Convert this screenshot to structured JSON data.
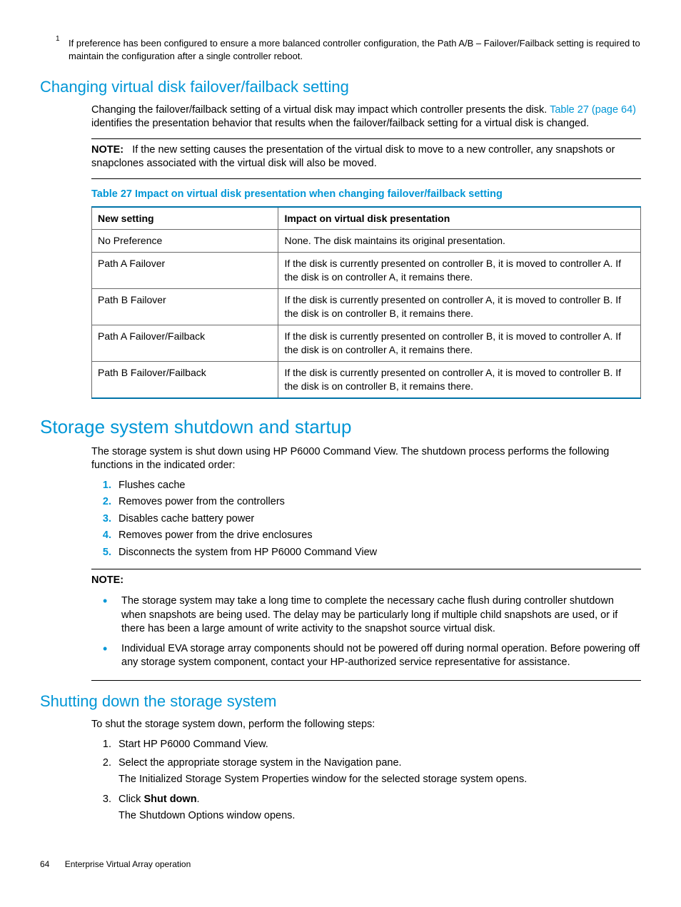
{
  "footnote": {
    "marker": "1",
    "text": "If preference has been configured to ensure a more balanced controller configuration, the Path A/B – Failover/Failback setting is required to maintain the configuration after a single controller reboot."
  },
  "section1": {
    "heading": "Changing virtual disk failover/failback setting",
    "p1a": "Changing the failover/failback setting of a virtual disk may impact which controller presents the disk. ",
    "p1_link": "Table 27 (page 64)",
    "p1b": " identifies the presentation behavior that results when the failover/failback setting for a virtual disk is changed.",
    "note_label": "NOTE:",
    "note_text": "If the new setting causes the presentation of the virtual disk to move to a new controller, any snapshots or snapclones associated with the virtual disk will also be moved.",
    "table_caption": "Table 27 Impact on virtual disk presentation when changing failover/failback setting",
    "table": {
      "headers": [
        "New setting",
        "Impact on virtual disk presentation"
      ],
      "rows": [
        [
          "No Preference",
          "None. The disk maintains its original presentation."
        ],
        [
          "Path A Failover",
          "If the disk is currently presented on controller B, it is moved to controller A. If the disk is on controller A, it remains there."
        ],
        [
          "Path B Failover",
          "If the disk is currently presented on controller A, it is moved to controller B. If the disk is on controller B, it remains there."
        ],
        [
          "Path A Failover/Failback",
          "If the disk is currently presented on controller B, it is moved to controller A. If the disk is on controller A, it remains there."
        ],
        [
          "Path B Failover/Failback",
          "If the disk is currently presented on controller A, it is moved to controller B. If the disk is on controller B, it remains there."
        ]
      ]
    }
  },
  "section2": {
    "heading": "Storage system shutdown and startup",
    "intro": "The storage system is shut down using HP P6000 Command View. The shutdown process performs the following functions in the indicated order:",
    "steps": [
      "Flushes cache",
      "Removes power from the controllers",
      "Disables cache battery power",
      "Removes power from the drive enclosures",
      "Disconnects the system from HP P6000 Command View"
    ],
    "note_label": "NOTE:",
    "note_bullets": [
      "The storage system may take a long time to complete the necessary cache flush during controller shutdown when snapshots are being used. The delay may be particularly long if multiple child snapshots are used, or if there has been a large amount of write activity to the snapshot source virtual disk.",
      "Individual EVA storage array components should not be powered off during normal operation. Before powering off any storage system component, contact your HP-authorized service representative for assistance."
    ]
  },
  "section3": {
    "heading": "Shutting down the storage system",
    "intro": "To shut the storage system down, perform the following steps:",
    "step1": "Start HP P6000 Command View.",
    "step2": "Select the appropriate storage system in the Navigation pane.",
    "step2_sub": "The Initialized Storage System Properties window for the selected storage system opens.",
    "step3_pre": "Click ",
    "step3_bold": "Shut down",
    "step3_post": ".",
    "step3_sub": "The Shutdown Options window opens."
  },
  "footer": {
    "page": "64",
    "title": "Enterprise Virtual Array operation"
  }
}
